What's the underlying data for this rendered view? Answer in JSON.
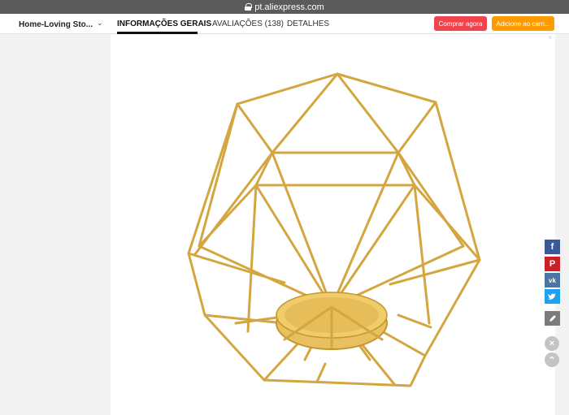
{
  "browser": {
    "url": "pt.aliexpress.com"
  },
  "nav": {
    "store_name": "Home-Loving Sto...",
    "tabs": [
      {
        "label": "INFORMAÇÕES GERAIS",
        "active": true
      },
      {
        "label": "AVALIAÇÕES (138)",
        "active": false
      },
      {
        "label": "DETALHES",
        "active": false
      }
    ],
    "buy_now": "Comprar agora",
    "add_to_cart": "Adicione ao carri..."
  },
  "product_image": {
    "description_icon": "gold-geometric-candle-holder"
  },
  "social": [
    "facebook-icon",
    "pinterest-icon",
    "vk-icon",
    "twitter-icon",
    "edit-icon"
  ],
  "colors": {
    "buy": "#f0434b",
    "cart": "#ff9a00",
    "gold": "#d4a640"
  }
}
